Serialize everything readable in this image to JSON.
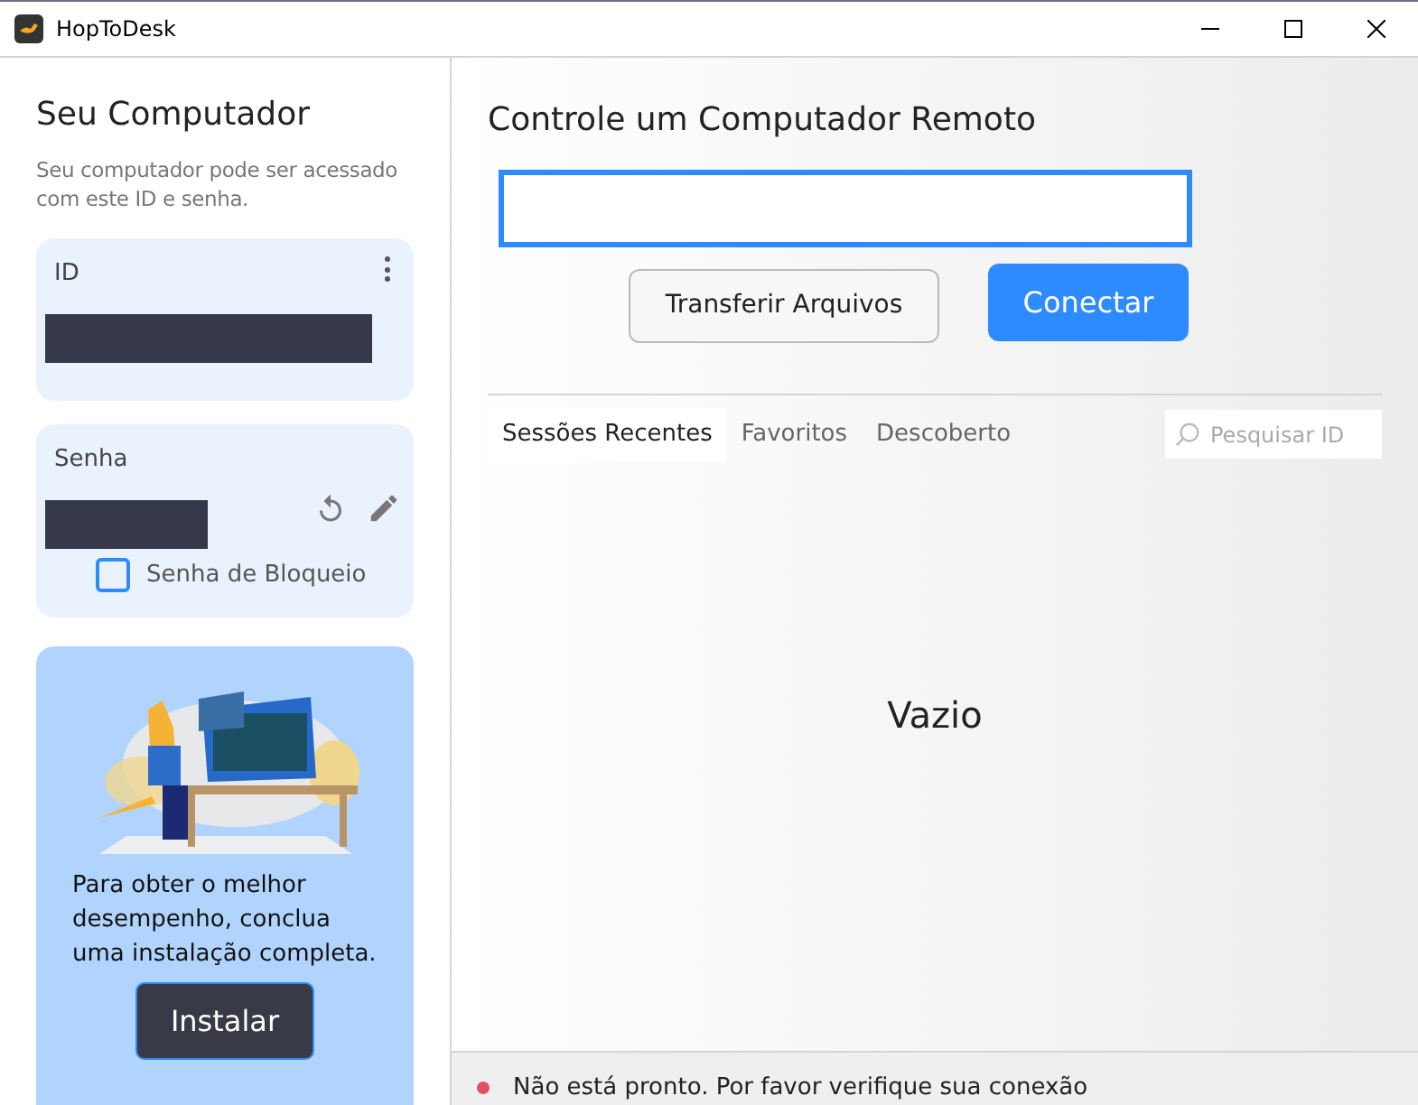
{
  "window": {
    "title": "HopToDesk"
  },
  "sidebar": {
    "title": "Seu Computador",
    "description": "Seu computador pode ser acessado com este ID e senha.",
    "id_card": {
      "label": "ID"
    },
    "password_card": {
      "label": "Senha",
      "lock_checkbox": {
        "label": "Senha de Bloqueio",
        "checked": false
      }
    },
    "install_card": {
      "text": "Para obter o melhor desempenho, conclua uma instalação completa.",
      "button": "Instalar"
    }
  },
  "main": {
    "title": "Controle um Computador Remoto",
    "buttons": [
      {
        "label": "Transferir Arquivos",
        "kind": "secondary"
      },
      {
        "label": "Conectar",
        "kind": "primary"
      }
    ],
    "tabs": [
      {
        "label": "Sessões Recentes",
        "selected": true
      },
      {
        "label": "Favoritos",
        "selected": false
      },
      {
        "label": "Descoberto",
        "selected": false
      }
    ],
    "search": {
      "placeholder": "Pesquisar ID"
    },
    "empty_message": "Vazio"
  },
  "status_bar": {
    "text": "Não está pronto. Por favor verifique sua conexão"
  }
}
